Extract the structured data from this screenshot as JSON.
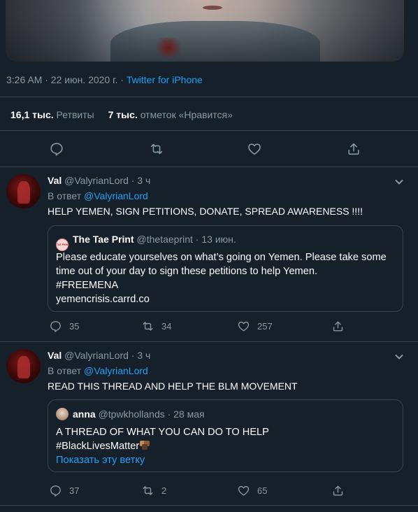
{
  "main_tweet": {
    "timestamp": "3:26 AM · 22 июн. 2020 г. · ",
    "source": "Twitter for iPhone",
    "retweets_count": "16,1 тыс.",
    "retweets_label": "Ретвиты",
    "likes_count": "7 тыс.",
    "likes_label": "отметок «Нравится»"
  },
  "replies": [
    {
      "display_name": "Val",
      "handle": "@ValyrianLord",
      "time": " · 3 ч",
      "reply_prefix": "В ответ ",
      "reply_mention": "@ValyrianLord",
      "text": "HELP YEMEN, SIGN PETITIONS, DONATE, SPREAD AWARENESS !!!!",
      "quote": {
        "name": "The Tae Print",
        "handle": "@thetaeprint",
        "time": " · 13 июн.",
        "line1": "Please educate yourselves on what’s going on Yemen. Please take some",
        "line2": "time out of your day to sign these petitions to help Yemen.",
        "line3": "#FREEMENA",
        "line4": "yemencrisis.carrd.co",
        "avatar_label": "TAE PRINT"
      },
      "counts": {
        "replies": "35",
        "retweets": "34",
        "likes": "257"
      }
    },
    {
      "display_name": "Val",
      "handle": "@ValyrianLord",
      "time": " · 3 ч",
      "reply_prefix": "В ответ ",
      "reply_mention": "@ValyrianLord",
      "text": "READ THIS THREAD AND HELP THE BLM MOVEMENT",
      "quote": {
        "name": "anna",
        "handle": "@tpwkhollands",
        "time": " · 28 мая",
        "line1": "A THREAD OF WHAT YOU CAN DO TO HELP",
        "line2": "#BlackLivesMatter",
        "show_thread": "Показать эту ветку"
      },
      "counts": {
        "replies": "37",
        "retweets": "2",
        "likes": "65"
      }
    }
  ],
  "colors": {
    "background": "#15202b",
    "border": "#38444d",
    "muted": "#8899a6",
    "link": "#1da1f2"
  },
  "icons": [
    "reply-icon",
    "retweet-icon",
    "like-icon",
    "share-icon",
    "chevron-down-icon"
  ]
}
